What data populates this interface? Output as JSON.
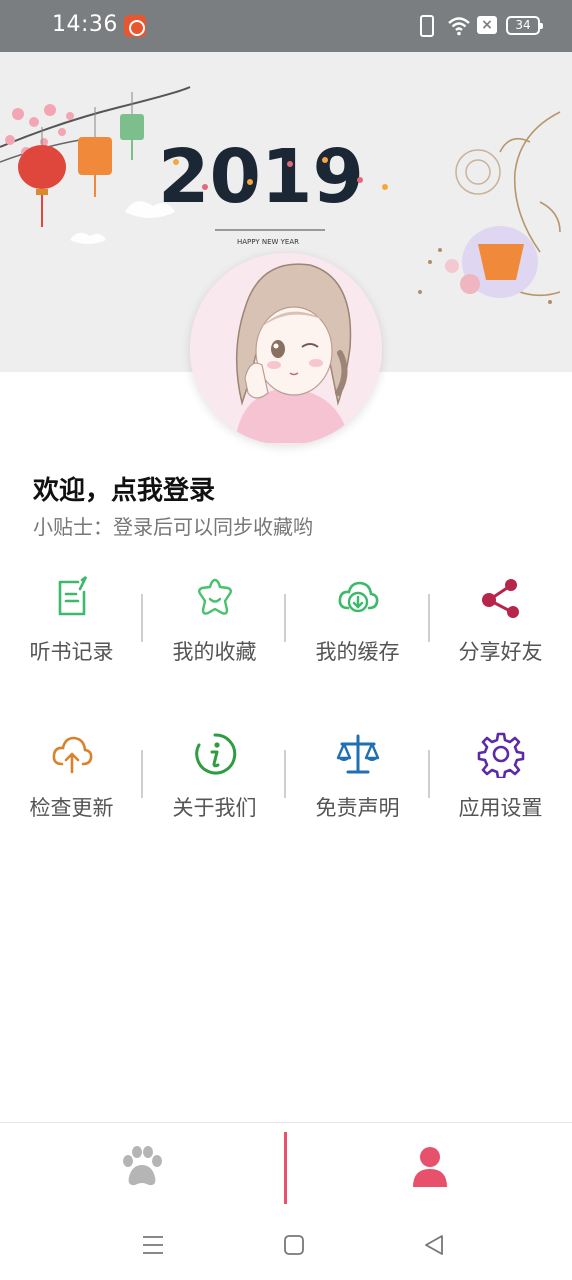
{
  "status_bar": {
    "time": "14:36",
    "battery": "34",
    "sim_icon": "sim-x-icon",
    "wifi_icon": "wifi-icon",
    "vibrate_icon": "vibrate-icon",
    "app_icon": "app-notification-icon"
  },
  "banner": {
    "year_text": "2019",
    "year_subtitle": "HAPPY NEW YEAR"
  },
  "welcome": {
    "title": "欢迎，点我登录",
    "tip": "小贴士：登录后可以同步收藏哟"
  },
  "menu_row_1": [
    {
      "label": "听书记录",
      "icon": "history-record-icon",
      "color": "#3cb96b"
    },
    {
      "label": "我的收藏",
      "icon": "star-favorite-icon",
      "color": "#48c16a"
    },
    {
      "label": "我的缓存",
      "icon": "cloud-download-icon",
      "color": "#3cb96b"
    },
    {
      "label": "分享好友",
      "icon": "share-icon",
      "color": "#b5264a"
    }
  ],
  "menu_row_2": [
    {
      "label": "检查更新",
      "icon": "cloud-upload-icon",
      "color": "#d9822b"
    },
    {
      "label": "关于我们",
      "icon": "info-icon",
      "color": "#2e9d3f"
    },
    {
      "label": "免责声明",
      "icon": "scale-icon",
      "color": "#1f6fb2"
    },
    {
      "label": "应用设置",
      "icon": "gear-icon",
      "color": "#5c2aa8"
    }
  ],
  "bottom_nav": {
    "left_icon": "paw-icon",
    "right_icon": "user-icon",
    "active_color": "#e8516b",
    "inactive_color": "#b5b5b5"
  },
  "system_nav": {
    "menu_icon": "menu-icon",
    "home_icon": "home-square-icon",
    "back_icon": "back-triangle-icon"
  }
}
